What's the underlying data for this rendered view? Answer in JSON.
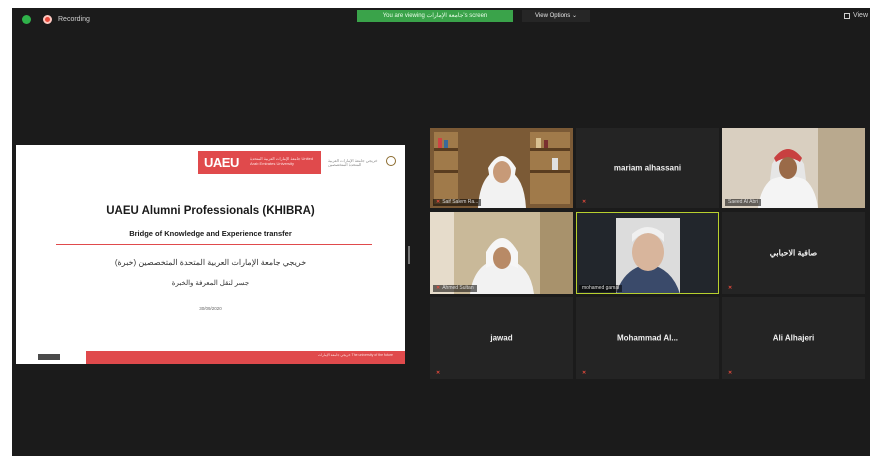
{
  "topbar": {
    "recording_label": "Recording",
    "banner_text": "You are viewing ‎جامعة الإمارات‎'s screen",
    "view_options_label": "View Options ⌄",
    "view_label": "View"
  },
  "slide": {
    "logo_text": "UAEU",
    "logo_subtext": "جامعة الإمارات العربية المتحدة United Arab Emirates University",
    "khibra_subtext": "خريجي جامعة الإمارات العربية المتحدة المتخصصين",
    "title": "UAEU Alumni Professionals (KHIBRA)",
    "subtitle": "Bridge of Knowledge and Experience transfer",
    "arabic_line1": "خريجي جامعة الإمارات العربية المتحدة المتخصصين (خبرة)",
    "arabic_line2": "جسر لنقل المعرفة والخبرة",
    "date": "30/09/2020",
    "footer_text": "خريجي جامعة الإمارات The university of the future"
  },
  "participants": [
    {
      "name": "Saif Salem Ra...",
      "display": "video",
      "muted": true
    },
    {
      "name": "mariam alhassani",
      "display": "name",
      "muted": true
    },
    {
      "name": "Saeed Al Abri",
      "display": "video",
      "muted": false
    },
    {
      "name": "Ahmed Sultan",
      "display": "video",
      "muted": true
    },
    {
      "name": "mohamed gamal",
      "display": "video",
      "muted": false,
      "active_speaker": true
    },
    {
      "name": "صافية الاحبابي",
      "display": "name",
      "muted": true
    },
    {
      "name": "jawad",
      "display": "name",
      "muted": true
    },
    {
      "name": "Mohammad Al...",
      "display": "name",
      "muted": true
    },
    {
      "name": "Ali Alhajeri",
      "display": "name",
      "muted": true
    }
  ],
  "colors": {
    "brand_red": "#e04a4c",
    "banner_green": "#3aa34a",
    "active_speaker_outline": "#b8d02e",
    "muted_icon": "#e84a3c"
  }
}
